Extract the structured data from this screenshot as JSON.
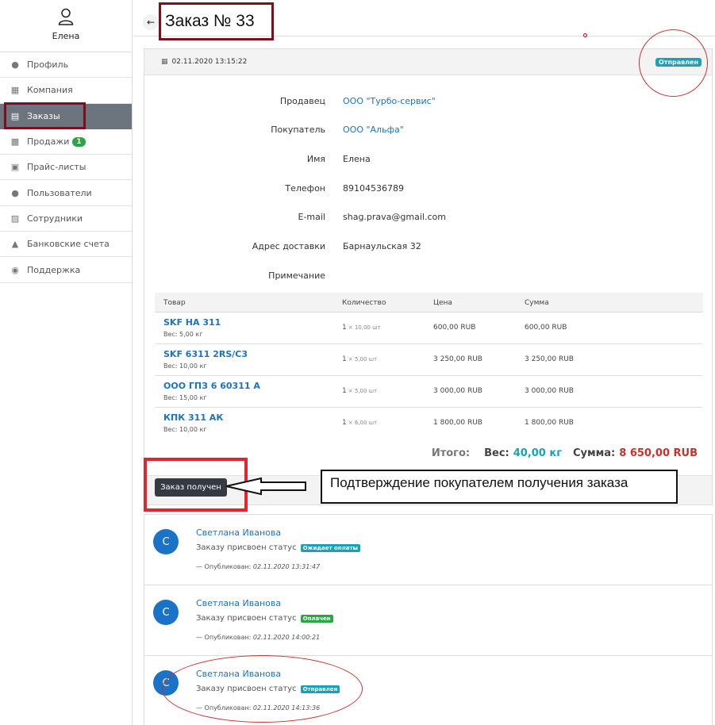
{
  "user": {
    "name": "Елена",
    "icon": "user-icon"
  },
  "sidebar": {
    "items": [
      {
        "label": "Профиль",
        "icon": "user-icon"
      },
      {
        "label": "Компания",
        "icon": "building-icon"
      },
      {
        "label": "Заказы",
        "icon": "basket-icon",
        "active": true
      },
      {
        "label": "Продажи",
        "icon": "sales-icon",
        "badge": "1"
      },
      {
        "label": "Прайс-листы",
        "icon": "money-icon"
      },
      {
        "label": "Пользователи",
        "icon": "users-icon"
      },
      {
        "label": "Сотрудники",
        "icon": "id-card-icon"
      },
      {
        "label": "Банковские счета",
        "icon": "bank-icon"
      },
      {
        "label": "Поддержка",
        "icon": "support-icon"
      }
    ]
  },
  "header": {
    "title": "Заказ № 33",
    "back_icon": "arrow-left-icon"
  },
  "order": {
    "datetime": "02.11.2020 13:15:22",
    "status": "Отправлен",
    "status_color": "#17a2b8",
    "fields": [
      {
        "label": "Продавец",
        "value": "ООО \"Турбо-сервис\"",
        "link": true
      },
      {
        "label": "Покупатель",
        "value": "ООО \"Альфа\"",
        "link": true
      },
      {
        "label": "Имя",
        "value": "Елена",
        "link": false
      },
      {
        "label": "Телефон",
        "value": "89104536789",
        "link": false
      },
      {
        "label": "E-mail",
        "value": "shag.prava@gmail.com",
        "link": false
      },
      {
        "label": "Адрес доставки",
        "value": "Барнаульская 32",
        "link": false
      },
      {
        "label": "Примечание",
        "value": "",
        "link": false
      }
    ],
    "table_headers": {
      "product": "Товар",
      "qty": "Количество",
      "price": "Цена",
      "sum": "Сумма"
    },
    "items": [
      {
        "name": "SKF HA 311",
        "weight": "Вес: 5,00 кг",
        "qty": "1",
        "qty_note": "× 10,00 шт",
        "price": "600,00 RUB",
        "sum": "600,00 RUB"
      },
      {
        "name": "SKF 6311 2RS/C3",
        "weight": "Вес: 10,00 кг",
        "qty": "1",
        "qty_note": "× 5,00 шт",
        "price": "3 250,00 RUB",
        "sum": "3 250,00 RUB"
      },
      {
        "name": "ООО ГПЗ 6 60311 А",
        "weight": "Вес: 15,00 кг",
        "qty": "1",
        "qty_note": "× 5,00 шт",
        "price": "3 000,00 RUB",
        "sum": "3 000,00 RUB"
      },
      {
        "name": "КПК 311 АК",
        "weight": "Вес: 10,00 кг",
        "qty": "1",
        "qty_note": "× 6,00 шт",
        "price": "1 800,00 RUB",
        "sum": "1 800,00 RUB"
      }
    ],
    "totals": {
      "label": "Итого:",
      "weight_label": "Вес:",
      "weight_value": "40,00 кг",
      "sum_label": "Сумма:",
      "sum_value": "8 650,00 RUB"
    },
    "receive_button": "Заказ получен"
  },
  "annotation_note": "Подтверждение покупателем получения заказа",
  "history": [
    {
      "avatar": "С",
      "author": "Светлана Иванова",
      "text": "Заказу присвоен статус",
      "status": "Ожидает оплаты",
      "status_color": "#17a2b8",
      "published_label": "— Опубликован:",
      "published_at": "02.11.2020 13:31:47"
    },
    {
      "avatar": "С",
      "author": "Светлана Иванова",
      "text": "Заказу присвоен статус",
      "status": "Оплачен",
      "status_color": "#28a745",
      "published_label": "— Опубликован:",
      "published_at": "02.11.2020 14:00:21"
    },
    {
      "avatar": "С",
      "author": "Светлана Иванова",
      "text": "Заказу присвоен статус",
      "status": "Отправлен",
      "status_color": "#17a2b8",
      "published_label": "— Опубликован:",
      "published_at": "02.11.2020 14:13:36"
    }
  ],
  "colors": {
    "annotation_dark_red": "#7b0f1d",
    "annotation_red": "#e2262f",
    "link_blue": "#1a73c7",
    "active_nav": "#6c757d"
  }
}
